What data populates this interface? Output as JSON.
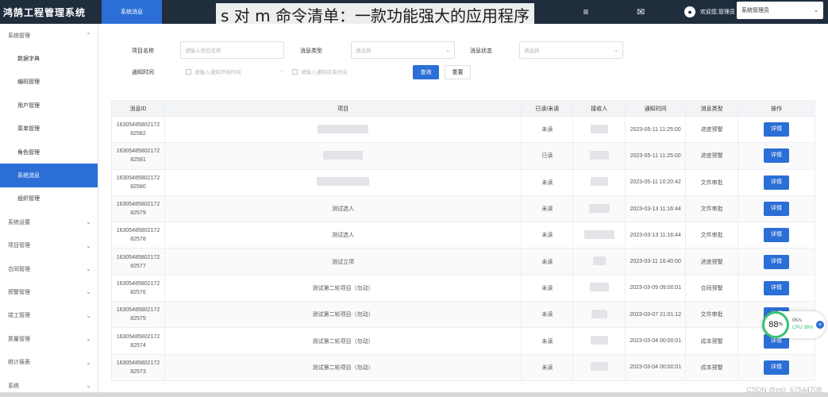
{
  "app": {
    "title": "鸿鹄工程管理系统",
    "active_tab": "系统消息"
  },
  "overlay_title": "s 对 m 命令清单：一款功能强大的应用程序",
  "header": {
    "user_text": "欢迎您,管理员",
    "role_select": "系统管理员"
  },
  "sidebar": {
    "items": [
      {
        "label": "系统管理",
        "type": "group",
        "expanded": true
      },
      {
        "label": "数据字典",
        "type": "sub"
      },
      {
        "label": "编码管理",
        "type": "sub"
      },
      {
        "label": "用户管理",
        "type": "sub"
      },
      {
        "label": "菜单管理",
        "type": "sub"
      },
      {
        "label": "角色管理",
        "type": "sub"
      },
      {
        "label": "系统消息",
        "type": "sub",
        "active": true
      },
      {
        "label": "组织管理",
        "type": "sub"
      },
      {
        "label": "系统设置",
        "type": "group"
      },
      {
        "label": "项目管理",
        "type": "group"
      },
      {
        "label": "合同管理",
        "type": "group"
      },
      {
        "label": "预警管理",
        "type": "group"
      },
      {
        "label": "竣工管理",
        "type": "group"
      },
      {
        "label": "质量管理",
        "type": "group"
      },
      {
        "label": "统计报表",
        "type": "group"
      },
      {
        "label": "系统",
        "type": "group"
      }
    ]
  },
  "filters": {
    "project_name_label": "项目名称",
    "project_name_placeholder": "请输入项目名称",
    "message_type_label": "消息类型",
    "message_type_placeholder": "请选择",
    "message_status_label": "消息状态",
    "message_status_placeholder": "请选择",
    "notify_time_label": "通知时间",
    "start_placeholder": "请输入通知开始时间",
    "range_sep": "-",
    "end_placeholder": "请输入通知结束时间",
    "query_button": "查询",
    "reset_button": "重置"
  },
  "table": {
    "columns": [
      "消息ID",
      "项目",
      "已读/未读",
      "接收人",
      "通知时间",
      "消息类型",
      "操作"
    ],
    "action_label": "详情",
    "rows": [
      {
        "id1": "16305485802172",
        "id2": "82582",
        "project": "",
        "read": "未读",
        "time": "2023-05-11 11:25:00",
        "type": "进度预警"
      },
      {
        "id1": "16305485802172",
        "id2": "82581",
        "project": "",
        "read": "已读",
        "time": "2023-05-11 11:25:00",
        "type": "进度预警"
      },
      {
        "id1": "16305485802172",
        "id2": "82580",
        "project": "",
        "read": "未读",
        "time": "2023-05-11 10:20:42",
        "type": "文件审批"
      },
      {
        "id1": "16305485802172",
        "id2": "82579",
        "project": "测试选人",
        "read": "未读",
        "time": "2023-03-13 11:16:44",
        "type": "文件审批"
      },
      {
        "id1": "16305485802172",
        "id2": "82578",
        "project": "测试选人",
        "read": "未读",
        "time": "2023-03-13 11:16:44",
        "type": "文件审批"
      },
      {
        "id1": "16305485802172",
        "id2": "82577",
        "project": "测试立项",
        "read": "未读",
        "time": "2023-03-11 16:40:00",
        "type": "进度预警"
      },
      {
        "id1": "16305485802172",
        "id2": "82576",
        "project": "测试第二轮项目（勿动）",
        "read": "未读",
        "time": "2023-03-09 09:00:01",
        "type": "合同预警"
      },
      {
        "id1": "16305485802172",
        "id2": "82575",
        "project": "测试第二轮项目（勿动）",
        "read": "未读",
        "time": "2023-03-07 21:01:12",
        "type": "文件审批"
      },
      {
        "id1": "16305485802172",
        "id2": "82574",
        "project": "测试第二轮项目（勿动）",
        "read": "未读",
        "time": "2023-03-04 00:00:01",
        "type": "成本预警"
      },
      {
        "id1": "16305485802172",
        "id2": "82573",
        "project": "测试第二轮项目（勿动）",
        "read": "未读",
        "time": "2023-03-04 00:00:01",
        "type": "成本预警"
      }
    ]
  },
  "monitor": {
    "value": "88",
    "unit": "%",
    "net": "0K/s",
    "cpu": "CPU 38%"
  },
  "watermark": "CSDN @m0_67544708",
  "colors": {
    "primary": "#2b6fd6",
    "header_bg": "#1f2d3d",
    "monitor_green": "#36c275"
  }
}
